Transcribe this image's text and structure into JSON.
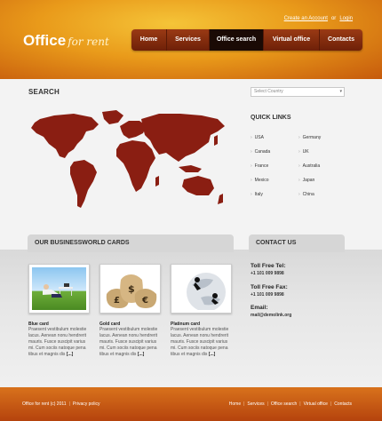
{
  "header": {
    "top_links": {
      "create_account": "Create an Account",
      "or": "or",
      "login": "Login"
    },
    "logo": {
      "word1": "Office",
      "word2": "for rent"
    },
    "nav": [
      "Home",
      "Services",
      "Office search",
      "Virtual office",
      "Contacts"
    ],
    "nav_active_index": 2
  },
  "search": {
    "title": "SEARCH",
    "select_placeholder": "Select Country",
    "quick_links_title": "QUICK LINKS",
    "quick_links": [
      "USA",
      "Germany",
      "Canada",
      "UK",
      "France",
      "Australia",
      "Mexico",
      "Japan",
      "Italy",
      "China"
    ]
  },
  "cards": {
    "title": "OUR BUSINESSWORLD CARDS",
    "items": [
      {
        "title": "Blue card",
        "text": "Praesent vestibulum molestie lacus. Aenean nonu hendrerit mauris. Fusce suscipit varius mi. Cum sociis natoque pena tibus et magnis dis",
        "more": "[...]"
      },
      {
        "title": "Gold card",
        "text": "Praesent vestibulum molestie lacus. Aenean nonu hendrerit mauris. Fusce suscipit varius mi. Cum sociis natoque pena tibus et magnis dis",
        "more": "[...]"
      },
      {
        "title": "Platinum card",
        "text": "Praesent vestibulum molestie lacus. Aenean nonu hendrerit mauris. Fusce suscipit varius mi. Cum sociis natoque pena tibus et magnis dis",
        "more": "[...]"
      }
    ]
  },
  "contact": {
    "title": "CONTACT US",
    "toll_free_tel_label": "Toll Free Tel:",
    "toll_free_tel": "+1 101 009 9898",
    "toll_free_fax_label": "Toll Free Fax:",
    "toll_free_fax": "+1 101 009 9898",
    "email_label": "Email:",
    "email": "mail@demolink.org"
  },
  "footer": {
    "copyright": "Office for rent  (c) 2011",
    "privacy": "Privacy policy",
    "nav": [
      "Home",
      "Services",
      "Office search",
      "Virtual office",
      "Contacts"
    ]
  }
}
